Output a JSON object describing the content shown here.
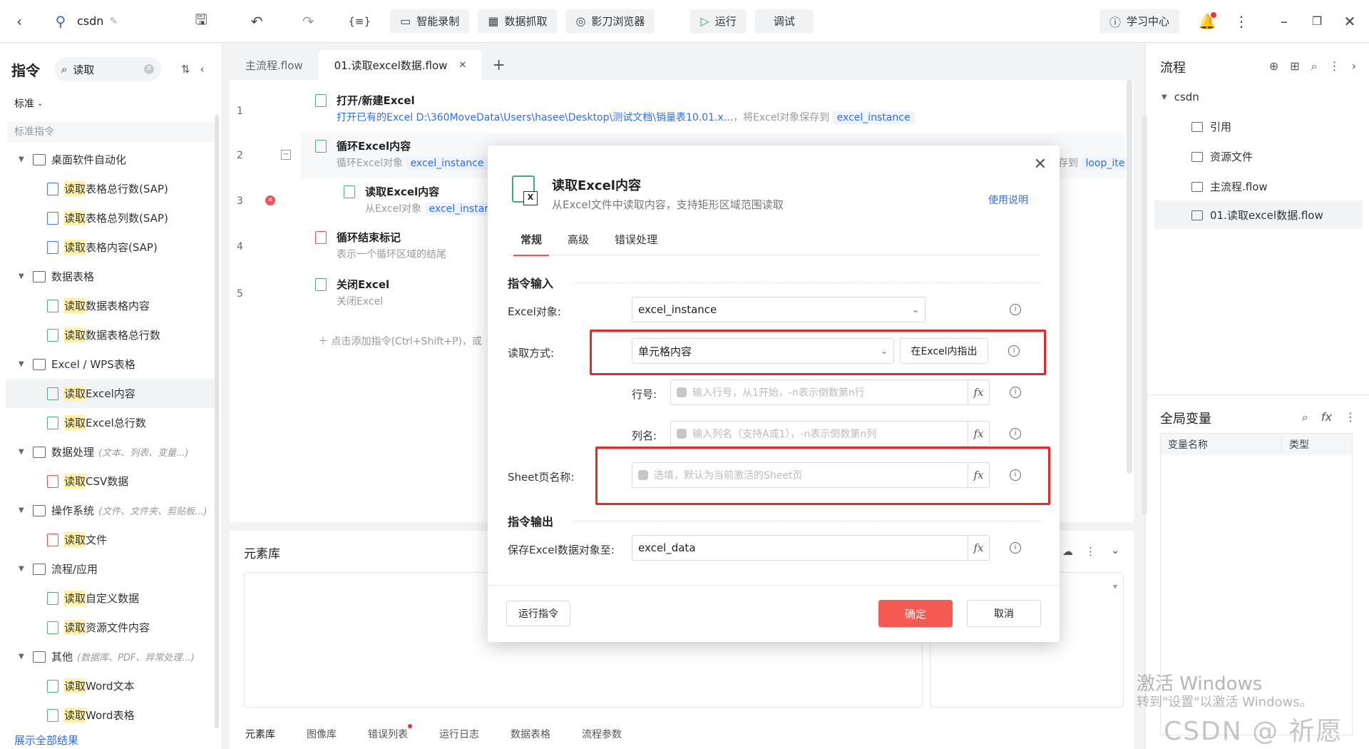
{
  "app": {
    "project_name": "csdn",
    "toolbar": {
      "record": "智能录制",
      "capture": "数据抓取",
      "browser": "影刀浏览器",
      "run": "运行",
      "debug": "调试",
      "learn": "学习中心"
    }
  },
  "left_panel": {
    "title": "指令",
    "search_value": "读取",
    "filter": "标准",
    "section": "标准指令",
    "show_all": "展示全部结果",
    "categories": [
      {
        "label": "桌面软件自动化",
        "hint": "",
        "items": [
          {
            "hl": "读取",
            "rest": "表格总行数(SAP)"
          },
          {
            "hl": "读取",
            "rest": "表格总列数(SAP)"
          },
          {
            "hl": "读取",
            "rest": "表格内容(SAP)"
          }
        ]
      },
      {
        "label": "数据表格",
        "hint": "",
        "items": [
          {
            "hl": "读取",
            "rest": "数据表格内容"
          },
          {
            "hl": "读取",
            "rest": "数据表格总行数"
          }
        ]
      },
      {
        "label": "Excel / WPS表格",
        "hint": "",
        "items": [
          {
            "hl": "读取",
            "rest": "Excel内容"
          },
          {
            "hl": "读取",
            "rest": "Excel总行数"
          }
        ]
      },
      {
        "label": "数据处理",
        "hint": "(文本、列表、变量...)",
        "items": [
          {
            "hl": "读取",
            "rest": "CSV数据"
          }
        ]
      },
      {
        "label": "操作系统",
        "hint": "(文件、文件夹、剪贴板...)",
        "items": [
          {
            "hl": "读取",
            "rest": "文件"
          }
        ]
      },
      {
        "label": "流程/应用",
        "hint": "",
        "items": [
          {
            "hl": "读取",
            "rest": "自定义数据"
          },
          {
            "hl": "读取",
            "rest": "资源文件内容"
          }
        ]
      },
      {
        "label": "其他",
        "hint": "(数据库、PDF、异常处理...)",
        "items": [
          {
            "hl": "读取",
            "rest": "Word文本"
          },
          {
            "hl": "读取",
            "rest": "Word表格"
          }
        ]
      }
    ]
  },
  "editor": {
    "tabs": [
      "主流程.flow",
      "01.读取excel数据.flow"
    ],
    "steps": [
      {
        "no": "1",
        "title": "打开/新建Excel",
        "desc": "打开已有的Excel D:\\360MoveData\\Users\\hasee\\Desktop\\测试文档\\销量表10.01.x...",
        "desc2": "，将Excel对象保存到",
        "var": "excel_instance"
      },
      {
        "no": "2",
        "title": "循环Excel内容",
        "desc": "循环Excel对象",
        "var": "excel_instance",
        "tail": "存到",
        "tail_var": "loop_ite"
      },
      {
        "no": "3",
        "title": "读取Excel内容",
        "desc": "从Excel对象",
        "var": "excel_instar"
      },
      {
        "no": "4",
        "title": "循环结束标记",
        "desc": "表示一个循环区域的结尾"
      },
      {
        "no": "5",
        "title": "关闭Excel",
        "desc": "关闭Excel"
      }
    ],
    "add_hint": "点击添加指令(Ctrl+Shift+P)，或"
  },
  "bottom_panel": {
    "title": "元素库",
    "tabs": [
      "元素库",
      "图像库",
      "错误列表",
      "运行日志",
      "数据表格",
      "流程参数"
    ]
  },
  "right_panel": {
    "title": "流程",
    "root": "csdn",
    "items": [
      "引用",
      "资源文件",
      "主流程.flow",
      "01.读取excel数据.flow"
    ],
    "vars_title": "全局变量",
    "vars_cols": [
      "变量名称",
      "类型"
    ]
  },
  "watermark": {
    "line1": "激活 Windows",
    "line2": "转到\"设置\"以激活 Windows。",
    "brand": "CSDN @ 祈愿"
  },
  "modal": {
    "title": "读取Excel内容",
    "subtitle": "从Excel文件中读取内容，支持矩形区域范围读取",
    "help": "使用说明",
    "tabs": [
      "常规",
      "高级",
      "错误处理"
    ],
    "input_section": "指令输入",
    "output_section": "指令输出",
    "excel_obj_label": "Excel对象:",
    "excel_obj_value": "excel_instance",
    "read_mode_label": "读取方式:",
    "read_mode_value": "单元格内容",
    "point_btn": "在Excel内指出",
    "row_label": "行号:",
    "row_placeholder": "输入行号，从1开始，-n表示倒数第n行",
    "col_label": "列名:",
    "col_placeholder": "输入列名（支持A或1），-n表示倒数第n列",
    "sheet_label": "Sheet页名称:",
    "sheet_placeholder": "选填，默认为当前激活的Sheet页",
    "save_label": "保存Excel数据对象至:",
    "save_value": "excel_data",
    "run_btn": "运行指令",
    "ok_btn": "确定",
    "cancel_btn": "取消"
  }
}
